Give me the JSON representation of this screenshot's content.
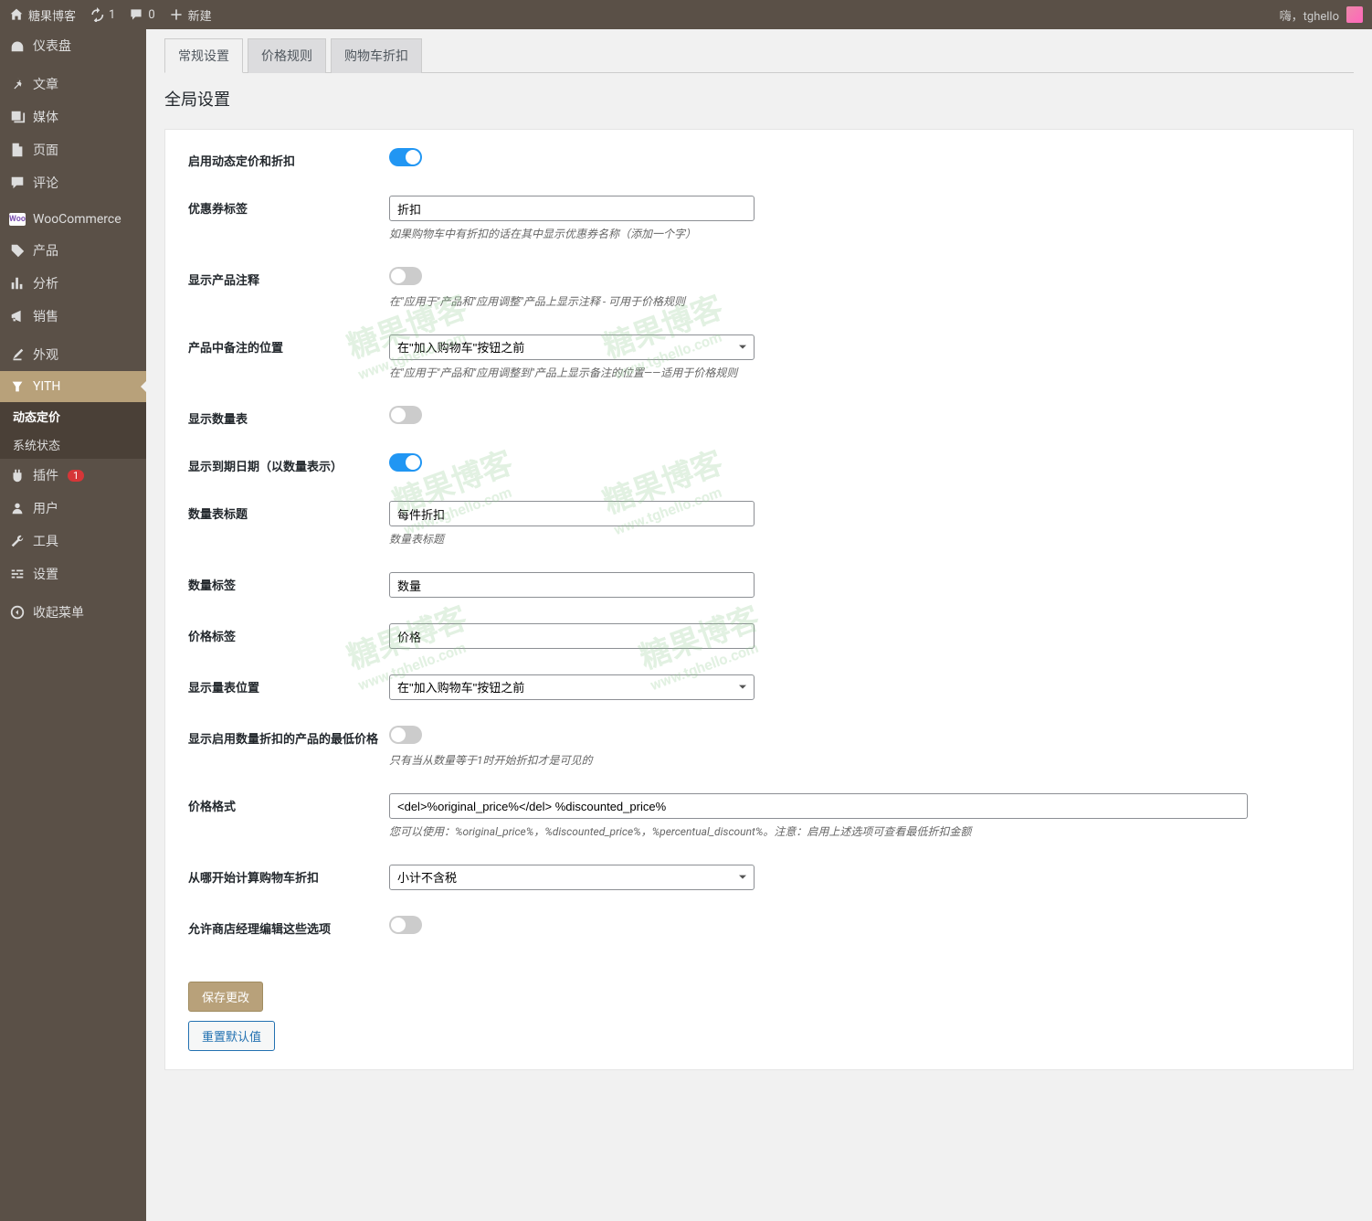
{
  "adminBar": {
    "siteName": "糖果博客",
    "updates": "1",
    "comments": "0",
    "new": "新建",
    "greeting": "嗨，tghello"
  },
  "sidebar": {
    "dashboard": "仪表盘",
    "posts": "文章",
    "media": "媒体",
    "pages": "页面",
    "comments": "评论",
    "woocommerce": "WooCommerce",
    "products": "产品",
    "analytics": "分析",
    "sales": "销售",
    "appearance": "外观",
    "yith": "YITH",
    "dynamicPricing": "动态定价",
    "systemStatus": "系统状态",
    "plugins": "插件",
    "pluginsBadge": "1",
    "users": "用户",
    "tools": "工具",
    "settings": "设置",
    "collapse": "收起菜单"
  },
  "tabs": {
    "general": "常规设置",
    "priceRules": "价格规则",
    "cartDiscount": "购物车折扣"
  },
  "pageTitle": "全局设置",
  "form": {
    "enableDynamic": {
      "label": "启用动态定价和折扣"
    },
    "couponLabel": {
      "label": "优惠券标签",
      "value": "折扣",
      "desc": "如果购物车中有折扣的话在其中显示优惠券名称（添加一个字）"
    },
    "showNote": {
      "label": "显示产品注释",
      "desc": "在\"应用于\"产品和\"应用调整\"产品上显示注释 - 可用于价格规则"
    },
    "notePosition": {
      "label": "产品中备注的位置",
      "value": "在\"加入购物车\"按钮之前",
      "desc": "在\"应用于\"产品和\"应用调整到\"产品上显示备注的位置——适用于价格规则"
    },
    "showQtyTable": {
      "label": "显示数量表"
    },
    "showExpiry": {
      "label": "显示到期日期（以数量表示）"
    },
    "qtyTableTitle": {
      "label": "数量表标题",
      "value": "每件折扣",
      "desc": "数量表标题"
    },
    "qtyLabel": {
      "label": "数量标签",
      "value": "数量"
    },
    "priceLabel": {
      "label": "价格标签",
      "value": "价格"
    },
    "tablePosition": {
      "label": "显示量表位置",
      "value": "在\"加入购物车\"按钮之前"
    },
    "showLowest": {
      "label": "显示启用数量折扣的产品的最低价格",
      "desc": "只有当从数量等于1时开始折扣才是可见的"
    },
    "priceFormat": {
      "label": "价格格式",
      "value": "<del>%original_price%</del> %discounted_price%",
      "desc": "您可以使用：%original_price%，%discounted_price%，%percentual_discount%。注意：启用上述选项可查看最低折扣金额"
    },
    "calcFrom": {
      "label": "从哪开始计算购物车折扣",
      "value": "小计不含税"
    },
    "allowManager": {
      "label": "允许商店经理编辑这些选项"
    }
  },
  "buttons": {
    "save": "保存更改",
    "reset": "重置默认值"
  },
  "watermark": {
    "main": "糖果博客",
    "sub": "www.tghello.com"
  }
}
